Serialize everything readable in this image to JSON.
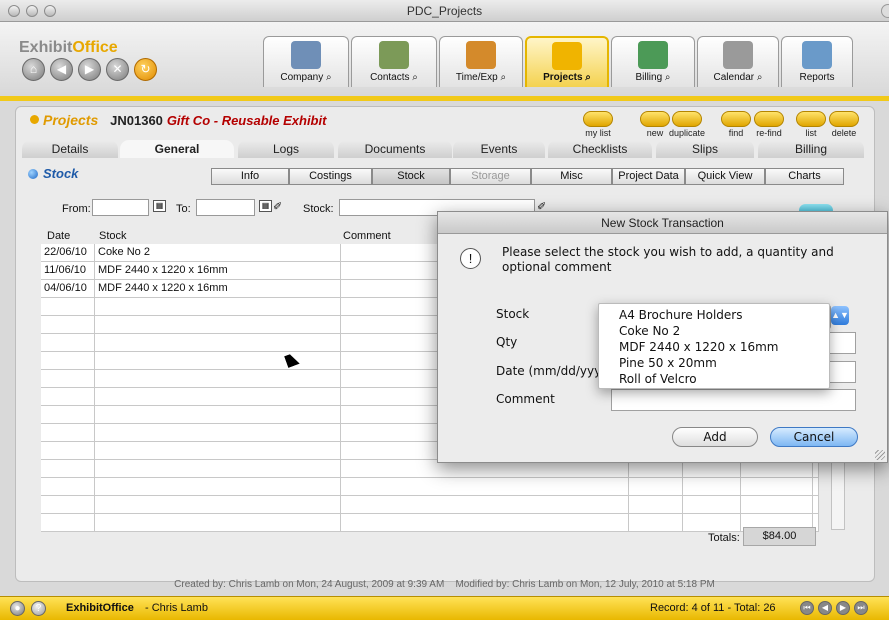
{
  "window": {
    "title": "PDC_Projects"
  },
  "brand": {
    "exhibit": "Exhibit",
    "office": "Office"
  },
  "main_tabs": [
    {
      "label": "Company",
      "magnifier": true
    },
    {
      "label": "Contacts",
      "magnifier": true
    },
    {
      "label": "Time/Exp",
      "magnifier": true
    },
    {
      "label": "Projects",
      "magnifier": true,
      "active": true
    },
    {
      "label": "Billing",
      "magnifier": true
    },
    {
      "label": "Calendar",
      "magnifier": true
    },
    {
      "label": "Reports",
      "magnifier": false
    }
  ],
  "header": {
    "section": "Projects",
    "job_number": "JN01360",
    "client": "Gift Co - Reusable Exhibit"
  },
  "toolbar": {
    "my_list": "my list",
    "new": "new",
    "duplicate": "duplicate",
    "find": "find",
    "refind": "re-find",
    "list": "list",
    "delete": "delete"
  },
  "record_tabs": [
    "Details",
    "General",
    "Logs",
    "Documents",
    "Events",
    "Checklists",
    "Slips",
    "Billing"
  ],
  "active_record_tab": "General",
  "section_title": "Stock",
  "sub_tabs": [
    "Info",
    "Costings",
    "Stock",
    "Storage",
    "Misc",
    "Project Data",
    "Quick View",
    "Charts"
  ],
  "active_sub_tab": "Stock",
  "disabled_sub_tab": "Storage",
  "filter": {
    "from_label": "From:",
    "to_label": "To:",
    "stock_label": "Stock:",
    "from_value": "",
    "to_value": "",
    "stock_value": ""
  },
  "table": {
    "headers": {
      "date": "Date",
      "stock": "Stock",
      "comment": "Comment"
    },
    "rows": [
      {
        "date": "22/06/10",
        "stock": "Coke No 2",
        "comment": ""
      },
      {
        "date": "11/06/10",
        "stock": "MDF  2440 x 1220 x 16mm",
        "comment": ""
      },
      {
        "date": "04/06/10",
        "stock": "MDF  2440 x 1220 x 16mm",
        "comment": ""
      }
    ],
    "totals_label": "Totals:",
    "totals_value": "$84.00"
  },
  "footer": {
    "created": "Created by: Chris Lamb on Mon, 24 August, 2009 at 9:39 AM",
    "modified": "Modified by: Chris Lamb on Mon, 12 July, 2010 at 5:18 PM"
  },
  "status": {
    "app": "ExhibitOffice",
    "user": "- Chris Lamb",
    "record": "Record: 4 of 11  -  Total: 26"
  },
  "dialog": {
    "title": "New Stock Transaction",
    "message": "Please select the stock you wish to add, a quantity and optional comment",
    "stock_label": "Stock",
    "qty_label": "Qty",
    "date_label": "Date (mm/dd/yyyy)",
    "comment_label": "Comment",
    "add_label": "Add",
    "cancel_label": "Cancel"
  },
  "stock_options": [
    "A4 Brochure Holders",
    "Coke No 2",
    "MDF  2440 x 1220 x 16mm",
    "Pine 50 x 20mm",
    "Roll of Velcro"
  ],
  "colors": {
    "accent_yellow": "#f1c919",
    "project_orange": "#e09a00",
    "client_red": "#b40000",
    "stock_blue": "#1e5aa8"
  }
}
